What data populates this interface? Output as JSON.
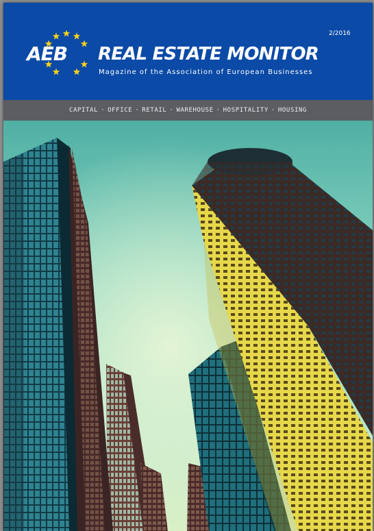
{
  "masthead": {
    "brand": "AEB",
    "title": "REAL ESTATE MONITOR",
    "subtitle": "Magazine of the Association of European Businesses",
    "issue": "2/2016"
  },
  "sectors": [
    "CAPITAL",
    "OFFICE",
    "RETAIL",
    "WAREHOUSE",
    "HOSPITALITY",
    "HOUSING"
  ],
  "separator": "·",
  "colors": {
    "masthead_blue": "#0b4aa6",
    "sector_bar": "#5b5d60",
    "star_yellow": "#f6d21a",
    "sky": "#7ecbb8"
  },
  "cover_image": {
    "icon": "skyscrapers-photo"
  }
}
